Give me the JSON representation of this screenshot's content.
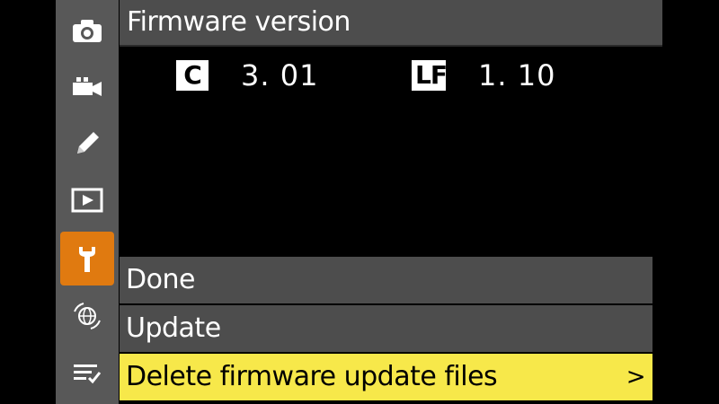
{
  "sidebar": {
    "items": [
      {
        "icon": "camera-icon"
      },
      {
        "icon": "movie-icon"
      },
      {
        "icon": "pencil-icon"
      },
      {
        "icon": "playback-icon"
      },
      {
        "icon": "wrench-icon",
        "active": true
      },
      {
        "icon": "network-icon"
      },
      {
        "icon": "my-menu-icon"
      }
    ],
    "active_color": "#e07a10"
  },
  "header": {
    "title": "Firmware version"
  },
  "firmware": {
    "c_label": "C",
    "c_version": "3. 01",
    "lf_label": "LF",
    "lf_version": "1. 10"
  },
  "menu": {
    "items": [
      {
        "label": "Done"
      },
      {
        "label": "Update"
      },
      {
        "label": "Delete firmware update files",
        "arrow": ">"
      }
    ],
    "selected_color": "#f7e84a"
  }
}
